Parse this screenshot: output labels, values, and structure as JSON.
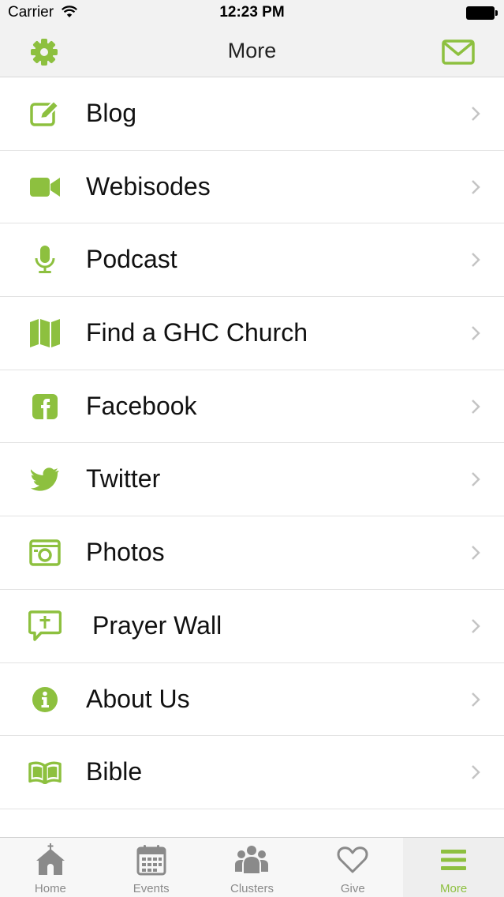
{
  "status_bar": {
    "carrier": "Carrier",
    "time": "12:23 PM"
  },
  "nav": {
    "title": "More"
  },
  "menu": [
    {
      "label": "Blog",
      "icon": "edit-icon"
    },
    {
      "label": "Webisodes",
      "icon": "video-camera-icon"
    },
    {
      "label": "Podcast",
      "icon": "microphone-icon"
    },
    {
      "label": "Find a GHC Church",
      "icon": "map-icon"
    },
    {
      "label": "Facebook",
      "icon": "facebook-icon"
    },
    {
      "label": "Twitter",
      "icon": "twitter-icon"
    },
    {
      "label": "Photos",
      "icon": "camera-icon"
    },
    {
      "label": "Prayer Wall",
      "icon": "prayer-bubble-icon"
    },
    {
      "label": "About Us",
      "icon": "info-icon"
    },
    {
      "label": "Bible",
      "icon": "open-book-icon"
    }
  ],
  "tabs": [
    {
      "label": "Home",
      "icon": "church-icon",
      "active": false
    },
    {
      "label": "Events",
      "icon": "calendar-icon",
      "active": false
    },
    {
      "label": "Clusters",
      "icon": "group-icon",
      "active": false
    },
    {
      "label": "Give",
      "icon": "heart-icon",
      "active": false
    },
    {
      "label": "More",
      "icon": "menu-icon",
      "active": true
    }
  ],
  "colors": {
    "accent": "#8dc03f",
    "tab_inactive": "#8a8a8a",
    "bar_background": "#f2f2f2"
  }
}
